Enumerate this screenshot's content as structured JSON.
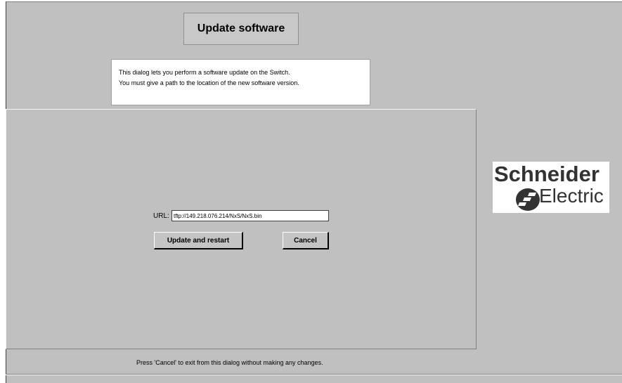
{
  "dialog": {
    "title": "Update software",
    "description_line1": "This dialog lets you perform a software update on the Switch.",
    "description_line2": "You must give a path to the location of the new software version."
  },
  "form": {
    "url_label": "URL:",
    "url_value": "tftp://149.218.076.214/NxS/NxS.bin",
    "update_button": "Update and restart",
    "cancel_button": "Cancel"
  },
  "logo": {
    "line1": "Schneider",
    "line2": "Electric",
    "icon": "schneider-electric-logo-mark"
  },
  "footer": {
    "hint": "Press 'Cancel' to exit from this dialog without making any changes."
  },
  "colors": {
    "background": "#c0c0c0",
    "logo_text": "#333333"
  }
}
